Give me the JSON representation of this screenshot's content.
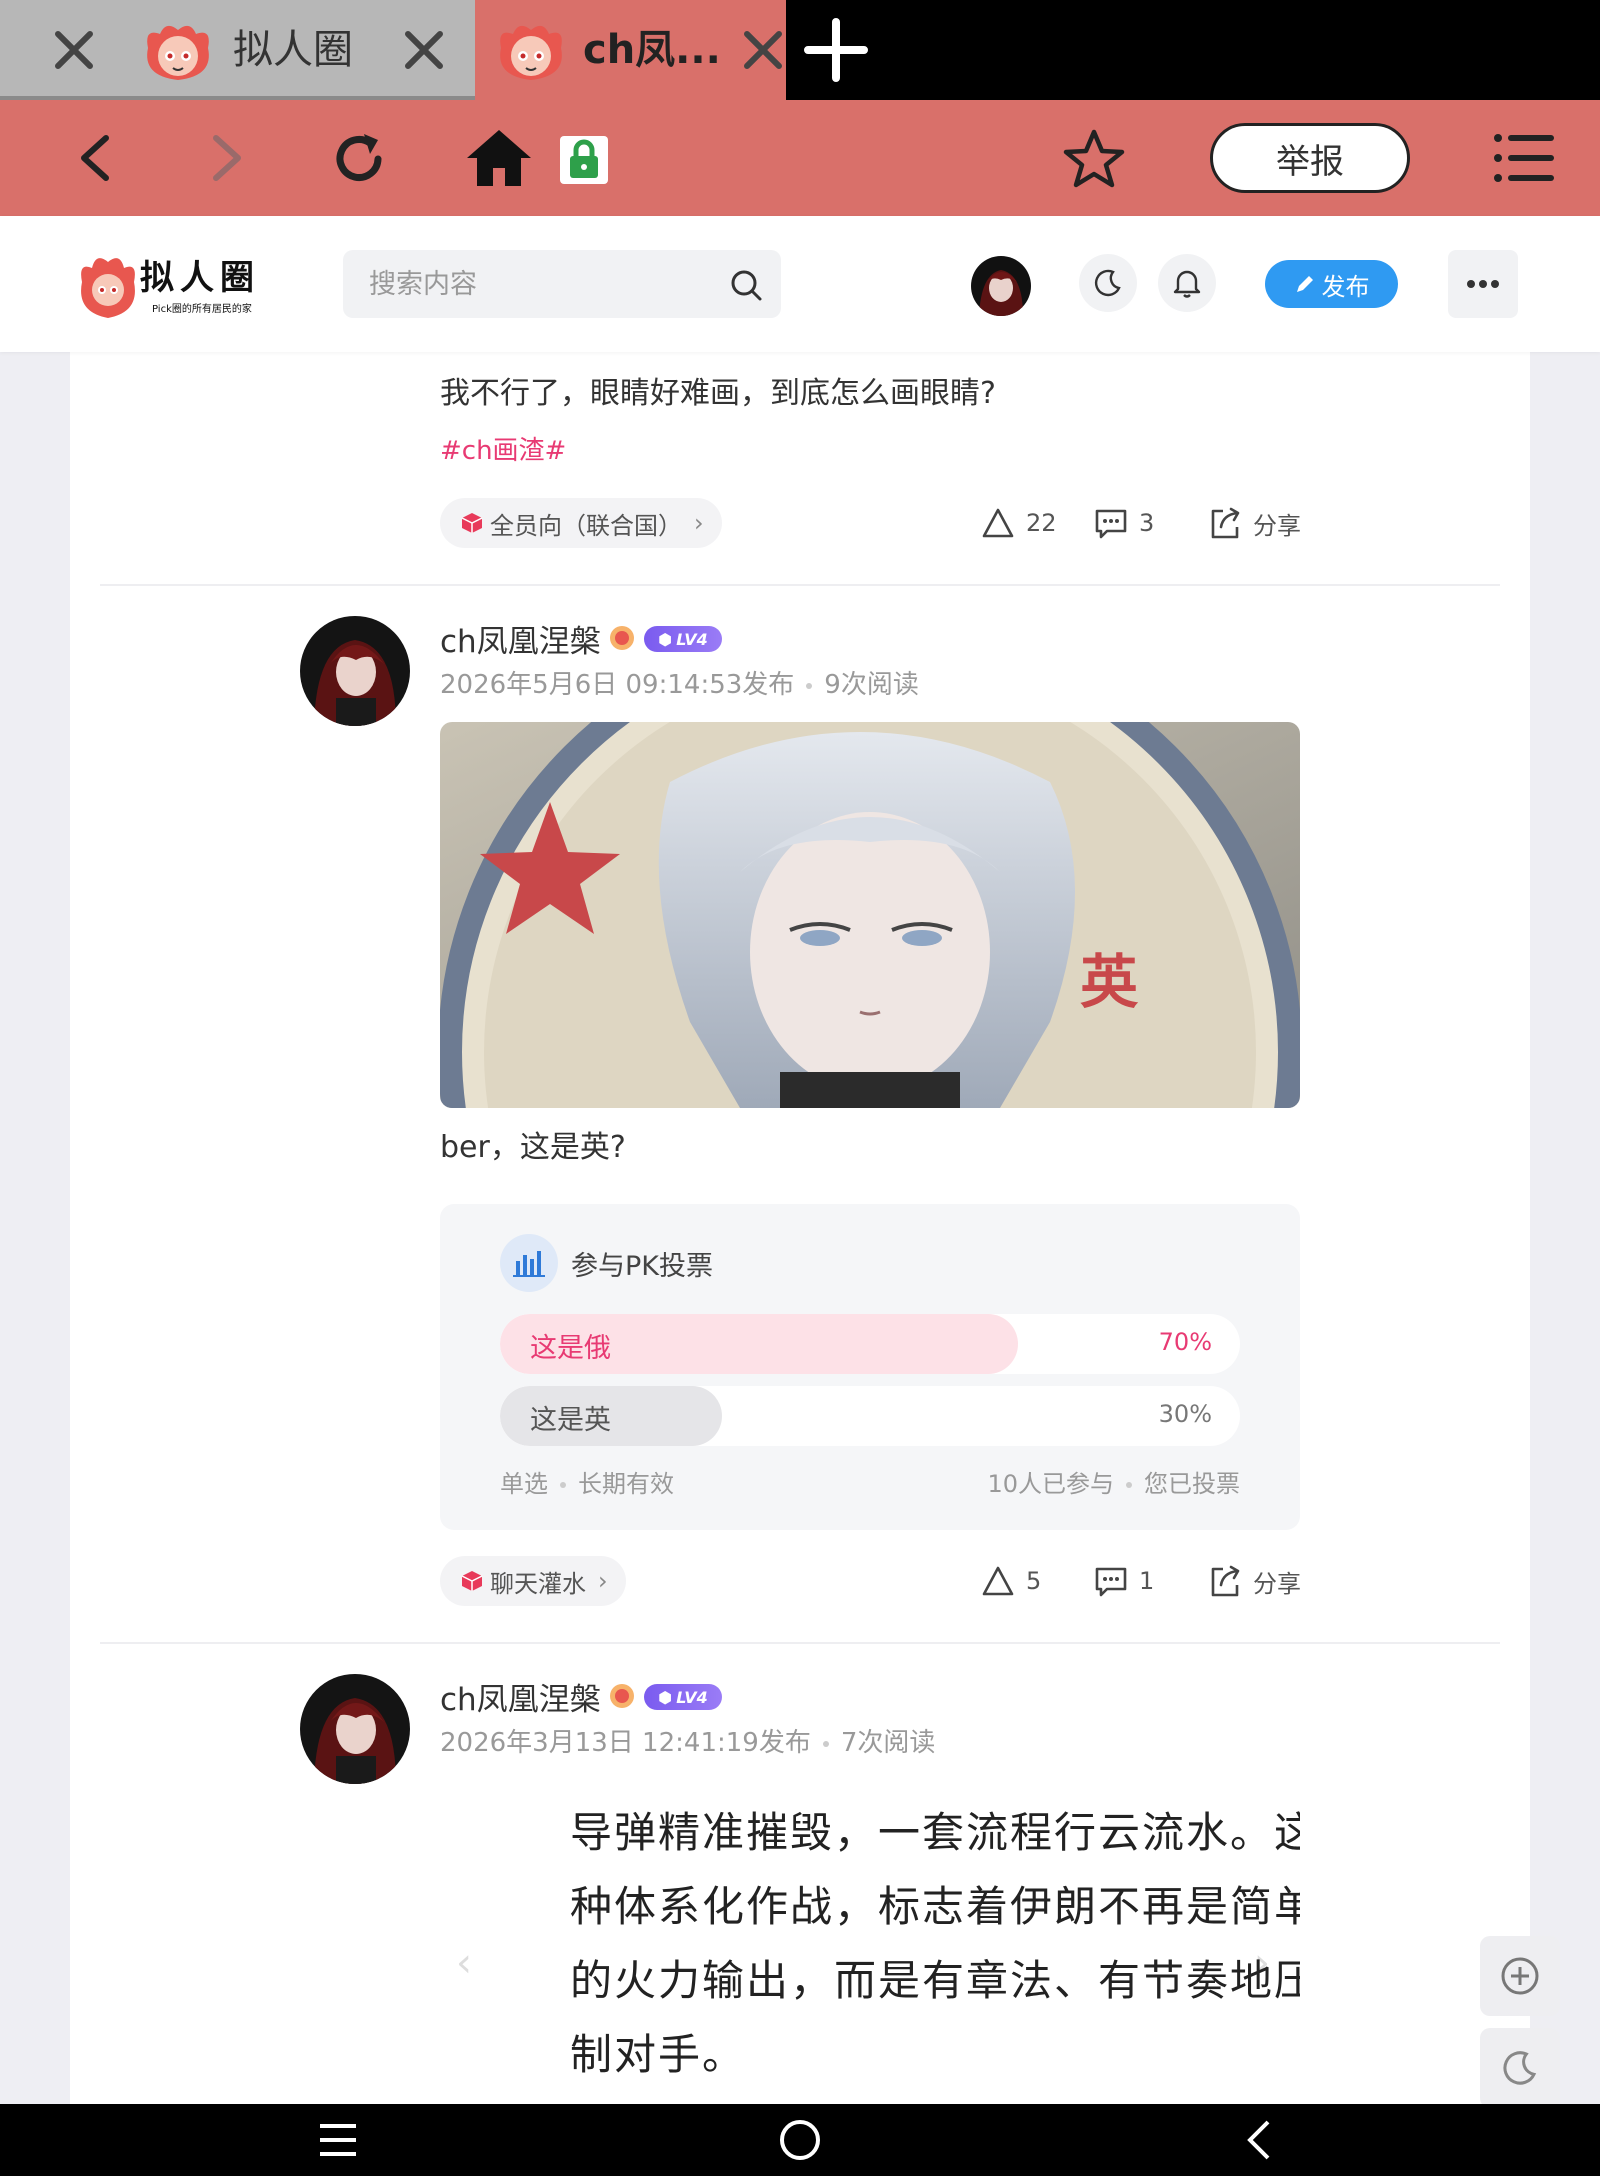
{
  "browser": {
    "tabs": [
      {
        "title": "拟人圈",
        "active": false
      },
      {
        "title": "ch凤...",
        "active": true
      }
    ],
    "toolbar": {
      "report_label": "举报"
    },
    "accent_color": "#d9706a"
  },
  "site": {
    "logo_title": "拟人圈",
    "logo_subtitle": "Pick圈的所有居民的家",
    "search": {
      "placeholder": "搜索内容"
    },
    "publish_label": "发布"
  },
  "posts": [
    {
      "text": "我不行了，眼睛好难画，到底怎么画眼睛?",
      "hashtag": "#ch画渣#",
      "tag": "全员向（联合国）",
      "likes": "22",
      "comments": "3",
      "share_label": "分享"
    },
    {
      "username": "ch凤凰涅槃",
      "level": "LV4",
      "date": "2026年5月6日 09:14:53发布",
      "views": "9次阅读",
      "text": "ber，这是英?",
      "poll": {
        "title": "参与PK投票",
        "options": [
          {
            "label": "这是俄",
            "percent": "70%",
            "value": 70
          },
          {
            "label": "这是英",
            "percent": "30%",
            "value": 30
          }
        ],
        "type": "单选",
        "validity": "长期有效",
        "participants": "10人已参与",
        "status": "您已投票"
      },
      "tag": "聊天灌水",
      "likes": "5",
      "comments": "1",
      "share_label": "分享"
    },
    {
      "username": "ch凤凰涅槃",
      "level": "LV4",
      "date": "2026年3月13日 12:41:19发布",
      "views": "7次阅读",
      "body_lines": [
        "导弹精准摧毁，一套流程行云流水。这",
        "种体系化作战，标志着伊朗不再是简单",
        "的火力输出，而是有章法、有节奏地压",
        "制对手。"
      ]
    }
  ],
  "colors": {
    "pink": "#e83a73",
    "blue": "#2f9af2",
    "level_purple": "#7a5bef"
  }
}
